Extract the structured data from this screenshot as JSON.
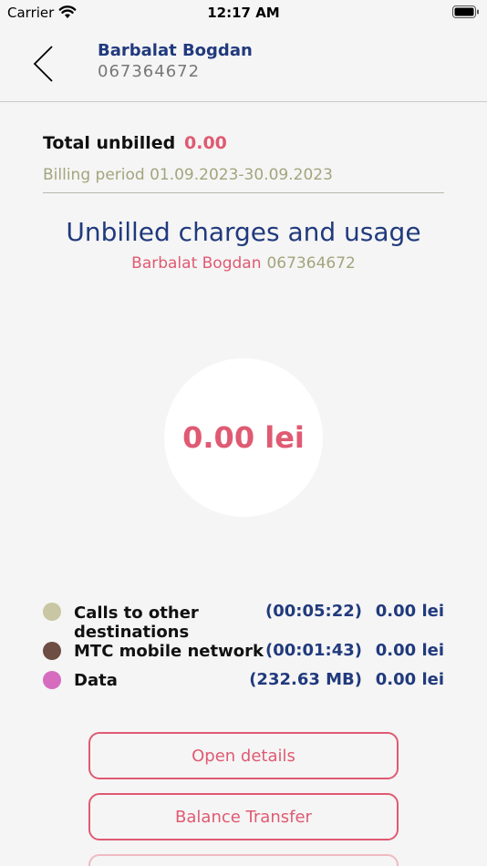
{
  "status_bar": {
    "carrier": "Carrier",
    "time": "12:17 AM"
  },
  "header": {
    "name": "Barbalat Bogdan",
    "phone": "067364672"
  },
  "summary": {
    "total_label": "Total unbilled",
    "total_value": "0.00",
    "billing_period": "Billing period 01.09.2023-30.09.2023"
  },
  "section": {
    "title": "Unbilled charges and usage",
    "name": "Barbalat Bogdan",
    "phone": "067364672"
  },
  "circle": {
    "amount": "0.00 lei"
  },
  "usage": [
    {
      "label": "Calls to other destinations",
      "duration": "(00:05:22)",
      "amount": "0.00 lei",
      "color": "#c9c7a3"
    },
    {
      "label": "MTC mobile network",
      "duration": "(00:01:43)",
      "amount": "0.00 lei",
      "color": "#6e4d44"
    },
    {
      "label": "Data",
      "duration": "(232.63 MB)",
      "amount": "0.00 lei",
      "color": "#d56cbf"
    }
  ],
  "buttons": {
    "open_details": "Open details",
    "balance_transfer": "Balance Transfer"
  },
  "colors": {
    "accent": "#df5a72",
    "navy": "#213a7d",
    "olive": "#a3a57d"
  }
}
